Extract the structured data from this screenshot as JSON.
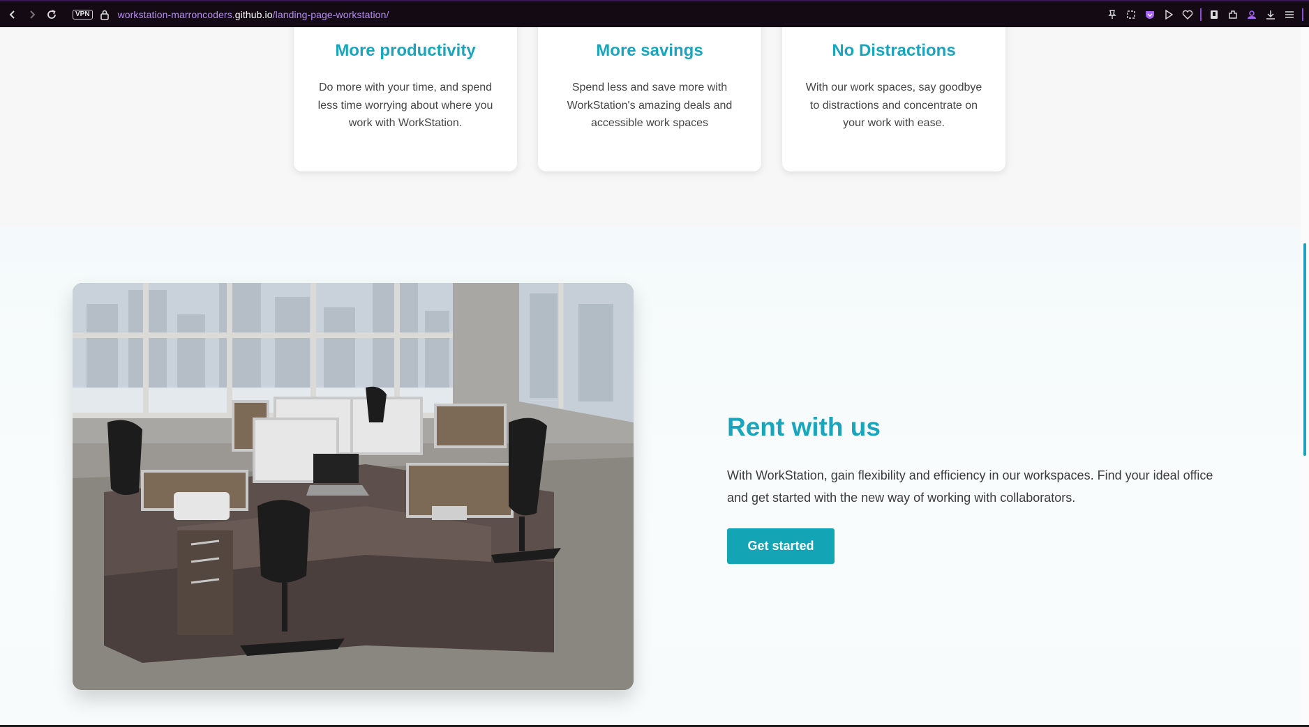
{
  "browser": {
    "url_prefix": "workstation-marroncoders.",
    "url_host": "github.io",
    "url_path": "/landing-page-workstation/",
    "vpn_label": "VPN"
  },
  "features": [
    {
      "title": "More productivity",
      "text": "Do more with your time, and spend less time worrying about where you work with WorkStation."
    },
    {
      "title": "More savings",
      "text": "Spend less and save more with WorkStation's amazing deals and accessible work spaces"
    },
    {
      "title": "No Distractions",
      "text": "With our work spaces, say goodbye to distractions and concentrate on your work with ease."
    }
  ],
  "rent": {
    "title": "Rent with us",
    "text": "With WorkStation, gain flexibility and efficiency in our workspaces. Find your ideal office and get started with the new way of working with collaborators.",
    "cta_label": "Get started"
  },
  "colors": {
    "accent": "#1aa5bd",
    "button": "#13a5b6",
    "toolbar_bg": "#130a14",
    "url_purple": "#b78cf5"
  }
}
